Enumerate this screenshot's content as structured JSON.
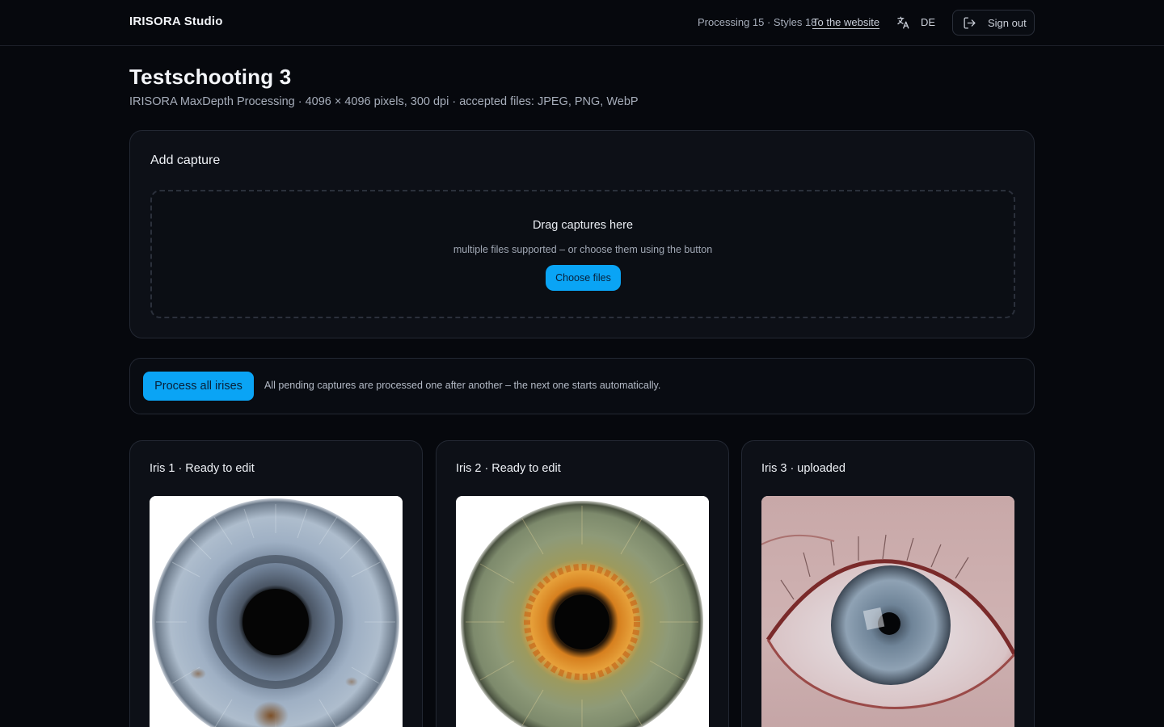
{
  "header": {
    "brand": "IRISORA Studio",
    "stats": "Processing 15 · Styles 18",
    "website_link": "To the website",
    "language": "DE",
    "signout_label": "Sign out"
  },
  "page": {
    "title": "Testschooting 3",
    "subtitle": "IRISORA MaxDepth Processing · 4096 × 4096 pixels, 300 dpi · accepted files: JPEG, PNG, WebP"
  },
  "upload": {
    "title": "Add capture",
    "drop_title": "Drag captures here",
    "drop_hint": "multiple files supported – or choose them using the button",
    "choose_label": "Choose files"
  },
  "process": {
    "button_label": "Process all irises",
    "hint": "All pending captures are processed one after another – the next one starts automatically."
  },
  "irises": [
    {
      "title": "Iris 1 · Ready to edit"
    },
    {
      "title": "Iris 2 · Ready to edit"
    },
    {
      "title": "Iris 3 · uploaded"
    }
  ],
  "colors": {
    "accent": "#0aa4f5",
    "background": "#06080d",
    "card": "#0d1017"
  }
}
